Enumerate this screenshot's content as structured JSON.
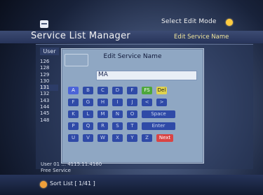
{
  "topbar": {
    "mode_text": "Select Edit Mode"
  },
  "header": {
    "title": "Service List Manager",
    "right_label": "Edit Service Name"
  },
  "list": {
    "tag": "User",
    "numbers": [
      "126",
      "128",
      "129",
      "130",
      "131",
      "132",
      "143",
      "144",
      "145",
      "148"
    ],
    "selected_index": 4
  },
  "dialog": {
    "title": "Edit Service Name",
    "input_value": "MA",
    "keys": [
      [
        "A",
        "B",
        "C",
        "D",
        "F",
        "FS",
        "Del"
      ],
      [
        "F",
        "G",
        "H",
        "I",
        "J",
        "<",
        ">"
      ],
      [
        "K",
        "L",
        "M",
        "N",
        "O",
        "Space"
      ],
      [
        "P",
        "Q",
        "R",
        "S",
        "T",
        "Enter"
      ],
      [
        "U",
        "V",
        "W",
        "X",
        "Y",
        "Z",
        "Next"
      ]
    ]
  },
  "footer_info": {
    "line1": "User 01 ... 4115.11.4160",
    "line2": "Free Service"
  },
  "bottom": {
    "sort_label": "Sort List",
    "sort_value": "[ 1/41 ]"
  }
}
